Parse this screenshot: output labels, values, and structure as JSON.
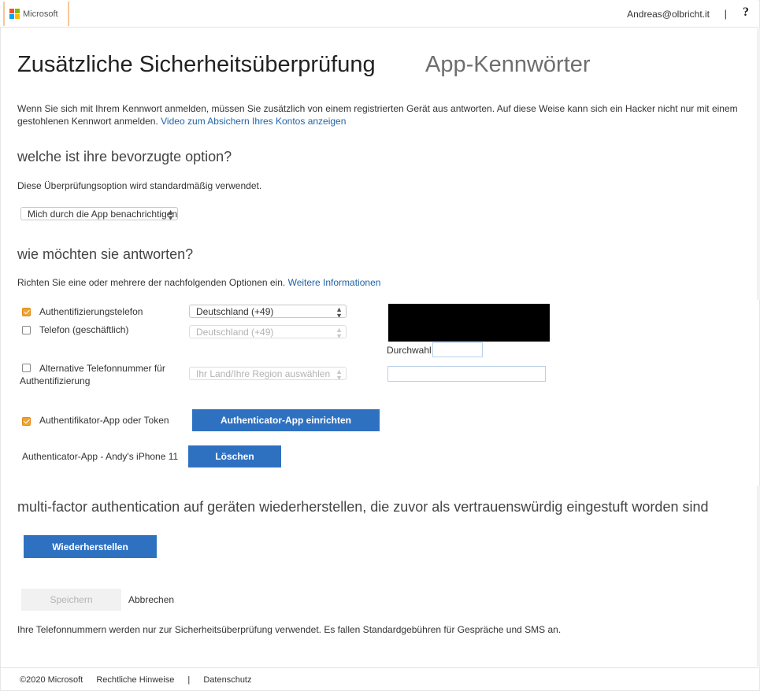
{
  "header": {
    "brand": "Microsoft",
    "user_email": "Andreas@olbricht.it",
    "separator": "|",
    "help_label": "?"
  },
  "page": {
    "title": "Zusätzliche Sicherheitsüberprüfung",
    "title_tab": "App-Kennwörter",
    "intro_text": "Wenn Sie sich mit Ihrem Kennwort anmelden, müssen Sie zusätzlich von einem registrierten Gerät aus antworten. Auf diese Weise kann sich ein Hacker nicht nur mit einem gestohlenen Kennwort anmelden.",
    "intro_link": "Video zum Absichern Ihres Kontos anzeigen"
  },
  "preferred": {
    "heading": "welche ist ihre bevorzugte option?",
    "description": "Diese Überprüfungsoption wird standardmäßig verwendet.",
    "selected": "Mich durch die App benachrichtigen"
  },
  "respond": {
    "heading": "wie möchten sie antworten?",
    "description": "Richten Sie eine oder mehrere der nachfolgenden Optionen ein.",
    "more_link": "Weitere Informationen",
    "options": [
      {
        "label": "Authentifizierungstelefon",
        "checked": true,
        "country": "Deutschland (+49)"
      },
      {
        "label": "Telefon (geschäftlich)",
        "checked": false,
        "country": "Deutschland (+49)"
      },
      {
        "label": "Alternative Telefonnummer für Authentifizierung",
        "checked": false,
        "country": "Ihr Land/Ihre Region auswählen"
      }
    ],
    "extension_label": "Durchwahl",
    "app_option_label": "Authentifikator-App oder Token",
    "app_setup_button": "Authenticator-App einrichten",
    "device_label": "Authenticator-App - Andy's iPhone 11",
    "delete_button": "Löschen"
  },
  "restore": {
    "heading": "multi-factor authentication auf geräten wiederherstellen, die zuvor als vertrauenswürdig eingestuft worden sind",
    "button": "Wiederherstellen"
  },
  "actions": {
    "save": "Speichern",
    "cancel": "Abbrechen",
    "notice": "Ihre Telefonnummern werden nur zur Sicherheitsüberprüfung verwendet. Es fallen Standardgebühren für Gespräche und SMS an."
  },
  "footer": {
    "copyright": "©2020 Microsoft",
    "legal": "Rechtliche Hinweise",
    "separator": "|",
    "privacy": "Datenschutz"
  },
  "colors": {
    "accent_blue": "#2f71c1",
    "link_blue": "#1f63a5",
    "checkbox_orange": "#f0a232",
    "ms_red": "#f25022",
    "ms_green": "#7fba00",
    "ms_blue": "#00a4ef",
    "ms_yellow": "#ffb900"
  }
}
